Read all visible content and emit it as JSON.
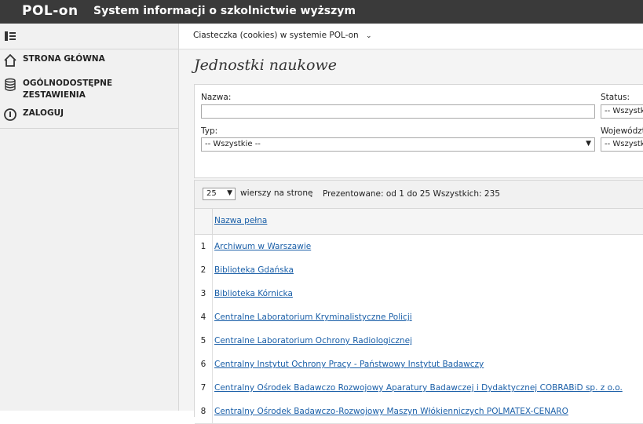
{
  "header": {
    "logo": "POL-on",
    "system_name": "System informacji o szkolnictwie wyższym"
  },
  "sidebar": {
    "items": [
      {
        "label": "STRONA GŁÓWNA",
        "icon": "home-icon"
      },
      {
        "label": "OGÓLNODOSTĘPNE\nZESTAWIENIA",
        "icon": "database-icon"
      },
      {
        "label": "ZALOGUJ",
        "icon": "power-icon"
      }
    ]
  },
  "topnav": {
    "cookies_label": "Ciasteczka (cookies) w systemie POL-on",
    "chevron": "⌄"
  },
  "page": {
    "title": "Jednostki naukowe"
  },
  "filters": {
    "name_label": "Nazwa:",
    "name_value": "",
    "status_label": "Status:",
    "status_value": "-- Wszystkie --",
    "type_label": "Typ:",
    "type_value": "-- Wszystkie --",
    "voivodeship_label": "Województwo:",
    "voivodeship_value": "-- Wszystkie --"
  },
  "table": {
    "rows_per_page": "25",
    "rows_per_page_label": "wierszy na stronę",
    "presented": "Prezentowane: od 1 do 25 Wszystkich: 235",
    "column_name": "Nazwa pełna",
    "rows": [
      {
        "num": "1",
        "name": "Archiwum w Warszawie"
      },
      {
        "num": "2",
        "name": "Biblioteka Gdańska"
      },
      {
        "num": "3",
        "name": "Biblioteka Kórnicka"
      },
      {
        "num": "4",
        "name": "Centralne Laboratorium Kryminalistyczne Policji"
      },
      {
        "num": "5",
        "name": "Centralne Laboratorium Ochrony Radiologicznej"
      },
      {
        "num": "6",
        "name": "Centralny Instytut Ochrony Pracy - Państwowy Instytut Badawczy"
      },
      {
        "num": "7",
        "name": "Centralny Ośrodek Badawczo Rozwojowy Aparatury Badawczej i Dydaktycznej COBRABiD sp. z o.o."
      },
      {
        "num": "8",
        "name": "Centralny Ośrodek Badawczo-Rozwojowy Maszyn Włókienniczych POLMATEX-CENARO"
      }
    ]
  },
  "colors": {
    "topbar": "#3a3a3a",
    "link": "#1a5fa8",
    "sidebar": "#f1f1f1"
  }
}
